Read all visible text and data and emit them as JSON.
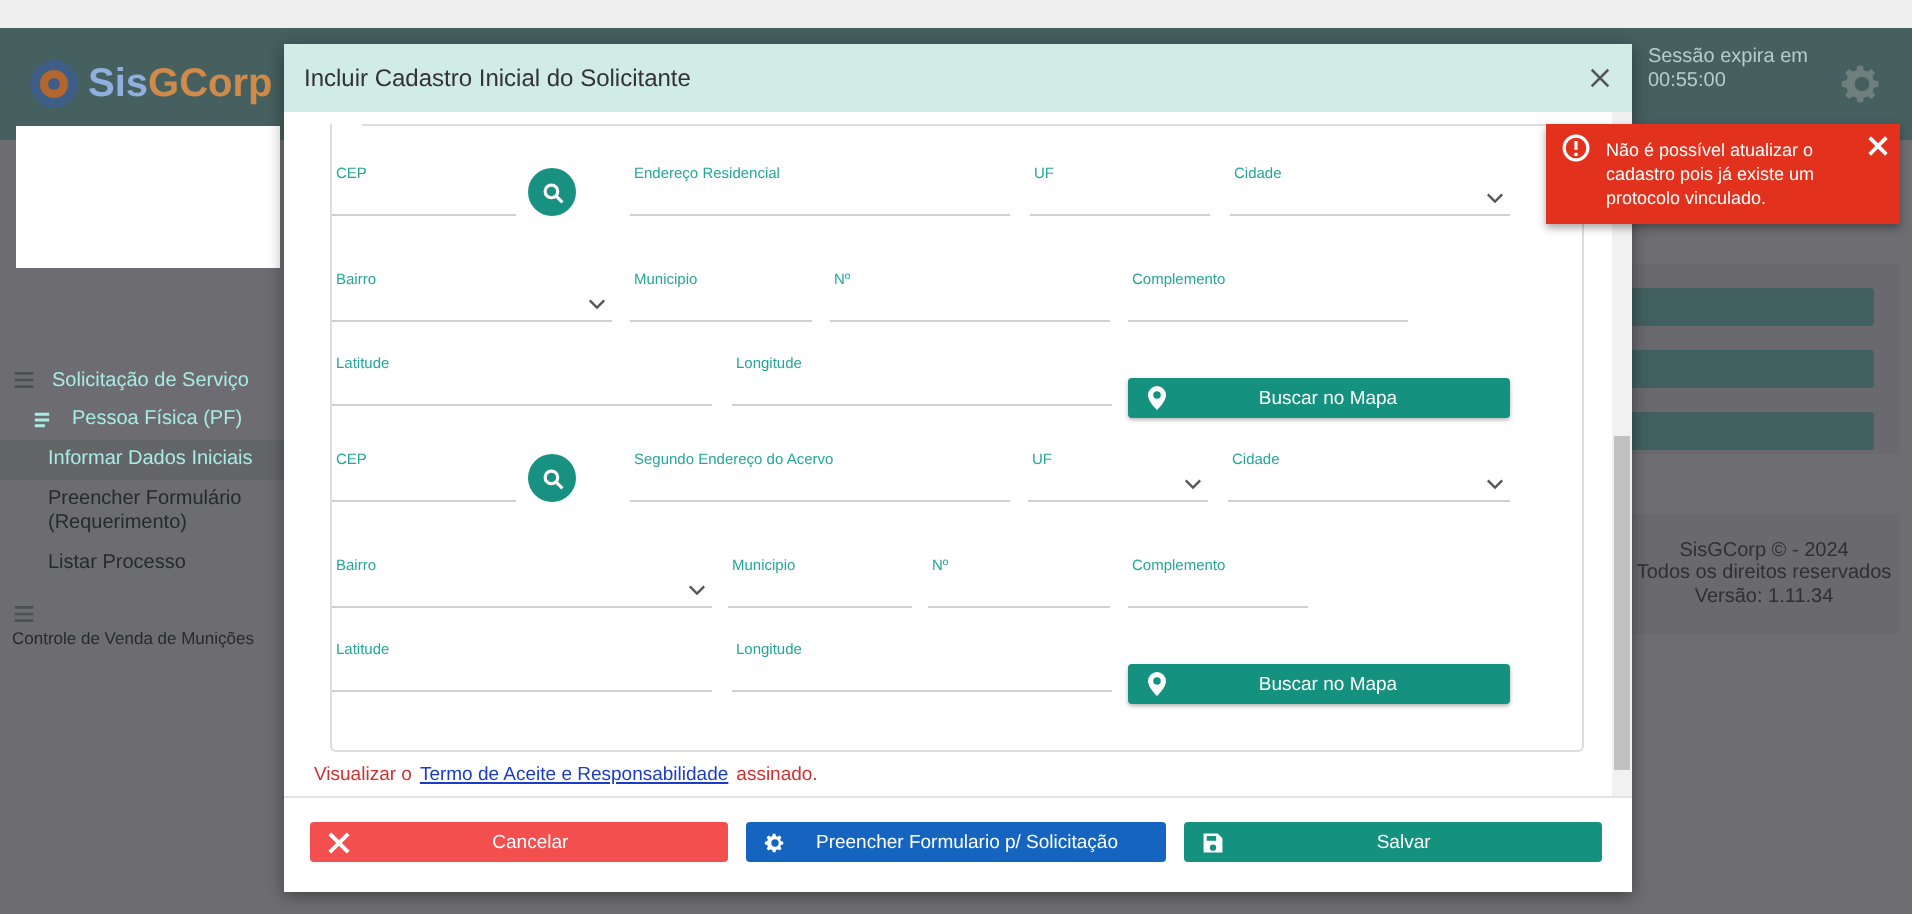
{
  "app": {
    "logo": [
      "Sis",
      "GCorp"
    ],
    "session": [
      "Sessão expira em",
      "00:55:00"
    ]
  },
  "sidebar": {
    "items": [
      {
        "label": "Solicitação de Serviço",
        "kind": "group",
        "children": [
          {
            "label": "Pessoa Física (PF)",
            "kind": "subgroup",
            "children": [
              {
                "label": "Informar Dados Iniciais",
                "kind": "leaf",
                "selected": true
              },
              {
                "label": "Preencher Formulário (Requerimento)",
                "kind": "leaf",
                "selected": false
              },
              {
                "label": "Listar Processo",
                "kind": "leaf",
                "selected": false
              }
            ]
          }
        ]
      },
      {
        "label": "Controle de Venda de Munições",
        "kind": "group"
      }
    ]
  },
  "footer": [
    "SisGCorp © - 2024",
    "Todos os direitos reservados",
    "Versão: 1.11.34"
  ],
  "modal": {
    "title": "Incluir Cadastro Inicial do Solicitante",
    "rows": [
      [
        {
          "kind": "text",
          "label": "CEP"
        },
        {
          "kind": "search"
        },
        {
          "kind": "text",
          "label": "Endereço Residencial"
        },
        {
          "kind": "text",
          "label": "UF"
        },
        {
          "kind": "select",
          "label": "Cidade"
        }
      ],
      [
        {
          "kind": "select",
          "label": "Bairro"
        },
        {
          "kind": "text",
          "label": "Municipio"
        },
        {
          "kind": "text",
          "label": "Nº"
        },
        {
          "kind": "text",
          "label": "Complemento"
        }
      ],
      [
        {
          "kind": "text",
          "label": "Latitude"
        },
        {
          "kind": "text",
          "label": "Longitude"
        },
        {
          "kind": "map",
          "label": "Buscar no Mapa"
        }
      ],
      [
        {
          "kind": "text",
          "label": "CEP"
        },
        {
          "kind": "search"
        },
        {
          "kind": "text",
          "label": "Segundo Endereço do Acervo"
        },
        {
          "kind": "select",
          "label": "UF"
        },
        {
          "kind": "select",
          "label": "Cidade"
        }
      ],
      [
        {
          "kind": "select",
          "label": "Bairro"
        },
        {
          "kind": "text",
          "label": "Municipio"
        },
        {
          "kind": "text",
          "label": "Nº"
        },
        {
          "kind": "text",
          "label": "Complemento"
        }
      ],
      [
        {
          "kind": "text",
          "label": "Latitude"
        },
        {
          "kind": "text",
          "label": "Longitude"
        },
        {
          "kind": "map",
          "label": "Buscar no Mapa"
        }
      ]
    ],
    "term": {
      "before": "Visualizar o",
      "link": "Termo de Aceite e Responsabilidade",
      "after": "assinado."
    },
    "buttons": [
      {
        "kind": "cancel",
        "label": "Cancelar"
      },
      {
        "kind": "form",
        "label": "Preencher Formulario p/ Solicitação"
      },
      {
        "kind": "save",
        "label": "Salvar"
      }
    ]
  },
  "toast": {
    "message": "Não é possível atualizar o cadastro pois já existe um protocolo vinculado."
  }
}
